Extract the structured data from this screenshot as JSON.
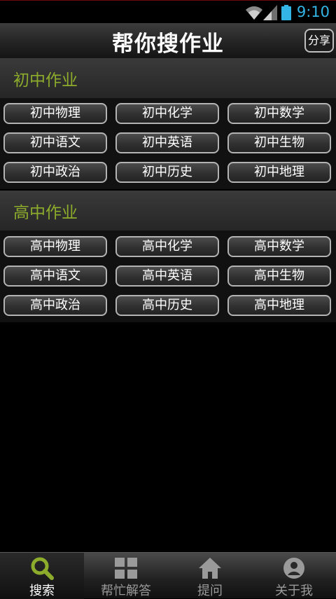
{
  "statusbar": {
    "clock": "9:10"
  },
  "header": {
    "title": "帮你搜作业",
    "share_label": "分享"
  },
  "sections": [
    {
      "title": "初中作业",
      "buttons": [
        "初中物理",
        "初中化学",
        "初中数学",
        "初中语文",
        "初中英语",
        "初中生物",
        "初中政治",
        "初中历史",
        "初中地理"
      ]
    },
    {
      "title": "高中作业",
      "buttons": [
        "高中物理",
        "高中化学",
        "高中数学",
        "高中语文",
        "高中英语",
        "高中生物",
        "高中政治",
        "高中历史",
        "高中地理"
      ]
    }
  ],
  "tabs": [
    {
      "label": "搜索",
      "icon": "search-icon",
      "active": true
    },
    {
      "label": "帮忙解答",
      "icon": "grid-icon",
      "active": false
    },
    {
      "label": "提问",
      "icon": "home-icon",
      "active": false
    },
    {
      "label": "关于我",
      "icon": "user-icon",
      "active": false
    }
  ],
  "colors": {
    "accent_green": "#8dac2c",
    "clock_blue": "#33b5e5"
  }
}
